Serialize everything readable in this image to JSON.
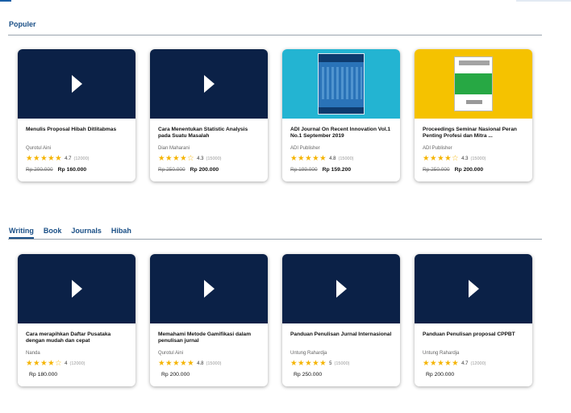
{
  "section_title": "Populer",
  "tabs": [
    "Writing",
    "Book",
    "Journals",
    "Hibah"
  ],
  "colors": {
    "accent": "#1a4f86",
    "video_bg": "#0b2147",
    "star": "#f5b400"
  },
  "populer": [
    {
      "thumb": "video",
      "title": "Menulis Proposal Hibah Ditlitabmas",
      "author": "Qurotul Aini",
      "rating": "4.7",
      "stars": 5,
      "count": "(12000)",
      "old_price": "Rp 200.000",
      "price": "Rp 160.000"
    },
    {
      "thumb": "video",
      "title": "Cara Menentukan Statistic Analysis pada Suatu Masalah",
      "author": "Dian Maharani",
      "rating": "4.3",
      "stars": 4,
      "count": "(15000)",
      "old_price": "Rp 250.000",
      "price": "Rp 200.000"
    },
    {
      "thumb": "journal-cover",
      "title": "ADI Journal On Recent Innovation Vol.1 No.1 September 2019",
      "author": "ADI Publisher",
      "rating": "4.8",
      "stars": 5,
      "count": "(15000)",
      "old_price": "Rp 199.000",
      "price": "Rp 159.200"
    },
    {
      "thumb": "proceedings-cover",
      "title": "Proceedings Seminar Nasional Peran Penting Profesi dan Mitra ...",
      "author": "ADI Publisher",
      "rating": "4.3",
      "stars": 4,
      "count": "(15000)",
      "old_price": "Rp 250.000",
      "price": "Rp 200.000"
    }
  ],
  "writing": [
    {
      "thumb": "video",
      "title": "Cara merapihkan Daftar Pusataka dengan mudah dan cepat",
      "author": "Nanda",
      "rating": "4",
      "stars": 4,
      "count": "(12000)",
      "price": "Rp 180.000"
    },
    {
      "thumb": "video",
      "title": "Memahami Metode Gamifikasi dalam penulisan jurnal",
      "author": "Qurotul Aini",
      "rating": "4.8",
      "stars": 5,
      "count": "(15000)",
      "price": "Rp 200.000"
    },
    {
      "thumb": "video",
      "title": "Panduan Penulisan Jurnal Internasional",
      "author": "Untung Rahardja",
      "rating": "5",
      "stars": 5,
      "count": "(15000)",
      "price": "Rp 250.000"
    },
    {
      "thumb": "video",
      "title": "Panduan Penulisan proposal CPPBT",
      "author": "Untung Rahardja",
      "rating": "4.7",
      "stars": 5,
      "count": "(12000)",
      "price": "Rp 200.000"
    }
  ]
}
